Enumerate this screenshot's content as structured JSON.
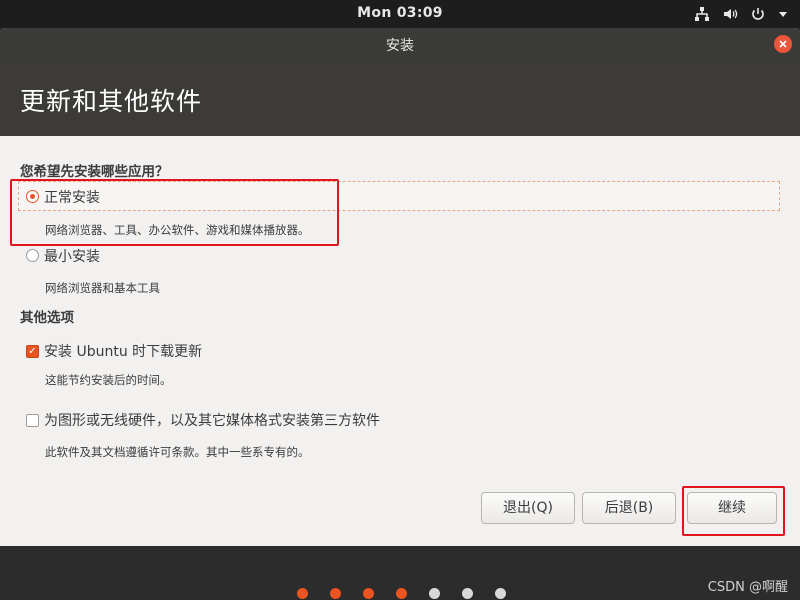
{
  "top_panel": {
    "clock": "Mon 03:09"
  },
  "window": {
    "title": "安装"
  },
  "header": {
    "title": "更新和其他软件"
  },
  "install_type": {
    "question": "您希望先安装哪些应用？",
    "options": [
      {
        "label": "正常安装",
        "description": "网络浏览器、工具、办公软件、游戏和媒体播放器。",
        "selected": true
      },
      {
        "label": "最小安装",
        "description": "网络浏览器和基本工具",
        "selected": false
      }
    ]
  },
  "other_options": {
    "heading": "其他选项",
    "items": [
      {
        "label": "安装 Ubuntu 时下载更新",
        "description": "这能节约安装后的时间。",
        "checked": true
      },
      {
        "label": "为图形或无线硬件，以及其它媒体格式安装第三方软件",
        "description": "此软件及其文档遵循许可条款。其中一些系专有的。",
        "checked": false
      }
    ]
  },
  "buttons": {
    "quit": "退出(Q)",
    "back": "后退(B)",
    "continue": "继续"
  },
  "progress": {
    "completed_steps": 4,
    "total_steps": 7
  },
  "watermark": "CSDN @啊醒",
  "colors": {
    "accent": "#e95420",
    "annotation": "#e3141e"
  }
}
